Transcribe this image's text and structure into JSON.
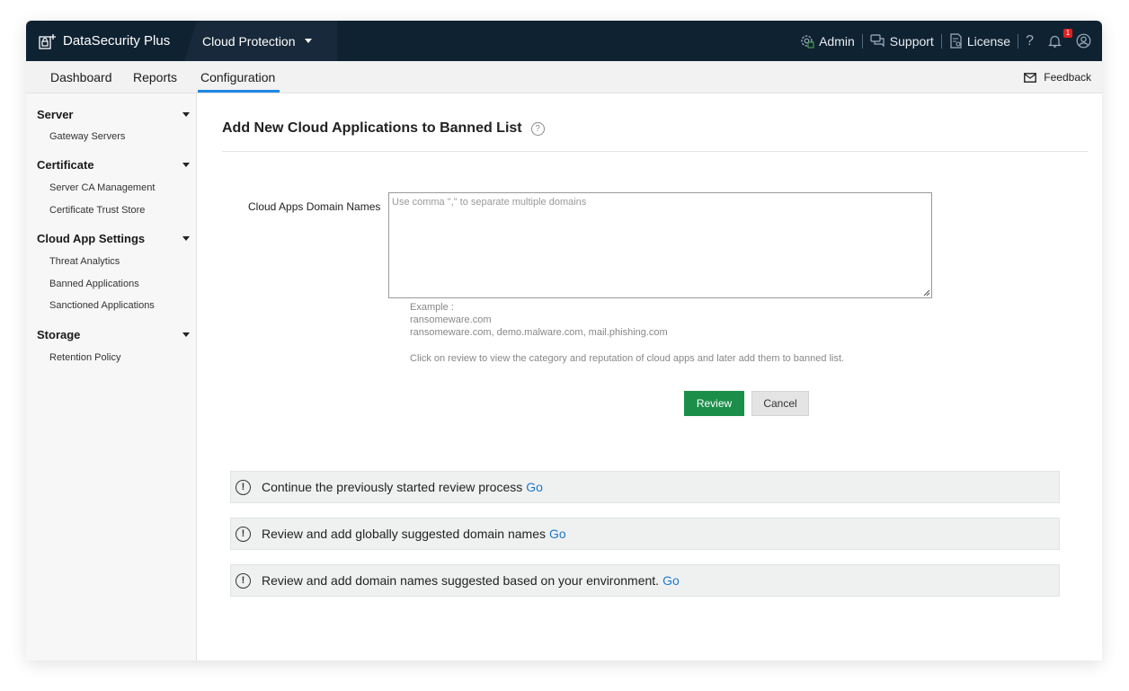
{
  "app": {
    "name": "DataSecurity Plus",
    "product": "Cloud Protection"
  },
  "topnav": {
    "admin": "Admin",
    "support": "Support",
    "license": "License",
    "help": "?",
    "notifications_count": "1"
  },
  "tabs": [
    "Dashboard",
    "Reports",
    "Configuration"
  ],
  "active_tab": "Configuration",
  "feedback": "Feedback",
  "sidebar": {
    "sections": [
      {
        "title": "Server",
        "items": [
          "Gateway Servers"
        ]
      },
      {
        "title": "Certificate",
        "items": [
          "Server CA Management",
          "Certificate Trust Store"
        ]
      },
      {
        "title": "Cloud App Settings",
        "items": [
          "Threat Analytics",
          "Banned Applications",
          "Sanctioned Applications"
        ]
      },
      {
        "title": "Storage",
        "items": [
          "Retention Policy"
        ]
      }
    ]
  },
  "page": {
    "title": "Add New Cloud Applications to Banned List",
    "field_label": "Cloud Apps Domain Names",
    "placeholder": "Use comma \",\" to separate multiple domains",
    "example_label": "Example :",
    "example_1": "ransomeware.com",
    "example_2": "ransomeware.com, demo.malware.com, mail.phishing.com",
    "hint": "Click on review to view the category and reputation of cloud apps and later add them to banned list.",
    "review_button": "Review",
    "cancel_button": "Cancel"
  },
  "notices": [
    {
      "text": "Continue the previously started review process",
      "link": "Go"
    },
    {
      "text": "Review and add globally suggested domain names",
      "link": "Go"
    },
    {
      "text": "Review and add domain names suggested based on your environment.",
      "link": "Go"
    }
  ],
  "colors": {
    "topbar": "#0f2232",
    "accent": "#1e88e5",
    "review": "#1b8f4a",
    "link": "#1e78c8"
  }
}
